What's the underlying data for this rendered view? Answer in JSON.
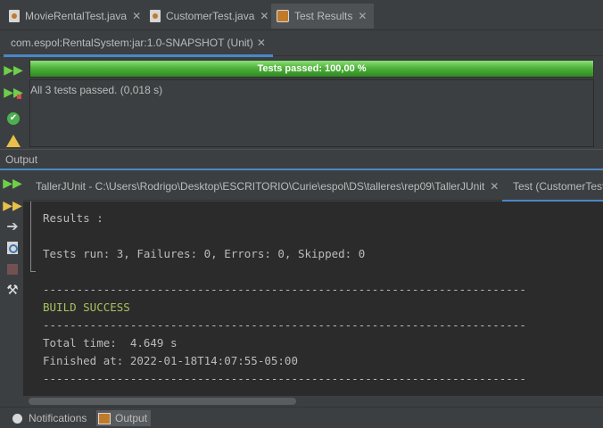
{
  "editor_tabs": [
    {
      "label": "MovieRentalTest.java",
      "close": "✕"
    },
    {
      "label": "CustomerTest.java",
      "close": "✕"
    },
    {
      "label": "Test Results",
      "close": "✕"
    }
  ],
  "runner": {
    "tab_label": "com.espol:RentalSystem:jar:1.0-SNAPSHOT (Unit)",
    "tab_close": "✕",
    "progress_text": "Tests passed: 100,00 %",
    "progress_fraction": 1.0,
    "status_text": "All 3 tests passed. (0,018 s)"
  },
  "output": {
    "title": "Output",
    "tabs": [
      {
        "label": "TallerJUnit - C:\\Users\\Rodrigo\\Desktop\\ESCRITORIO\\Curie\\espol\\DS\\talleres\\rep09\\TallerJUnit",
        "close": "✕"
      },
      {
        "label": "Test (CustomerTest"
      }
    ],
    "console_lines": [
      "Results :",
      "",
      "Tests run: 3, Failures: 0, Errors: 0, Skipped: 0",
      "",
      "------------------------------------------------------------------------",
      "BUILD SUCCESS",
      "------------------------------------------------------------------------",
      "Total time:  4.649 s",
      "Finished at: 2022-01-18T14:07:55-05:00",
      "------------------------------------------------------------------------"
    ]
  },
  "statusbar": {
    "notifications_label": "Notifications",
    "output_label": "Output"
  },
  "colors": {
    "accent": "#4a88c7",
    "success_text": "#a5c25c",
    "progress_green": "#4fb33a",
    "rerun_green": "#6fcf4a",
    "warning_yellow": "#e8c04a"
  }
}
